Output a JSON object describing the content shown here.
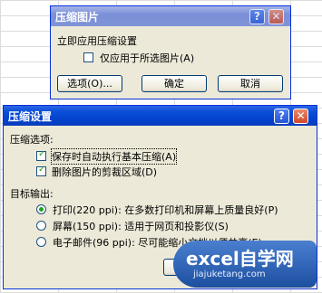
{
  "back_dialog": {
    "title": "压缩图片",
    "group_label": "立即应用压缩设置",
    "checkbox_label": "仅应用于所选图片(A)",
    "buttons": {
      "options": "选项(O)...",
      "ok": "确定",
      "cancel": "取消"
    }
  },
  "front_dialog": {
    "title": "压缩设置",
    "compress_group_label": "压缩选项:",
    "compress_options": [
      {
        "label": "保存时自动执行基本压缩(A)",
        "checked": true
      },
      {
        "label": "删除图片的剪裁区域(D)",
        "checked": true
      }
    ],
    "target_group_label": "目标输出:",
    "target_options": [
      {
        "label": "打印(220 ppi): 在多数打印机和屏幕上质量良好(P)",
        "selected": true
      },
      {
        "label": "屏幕(150 ppi): 适用于网页和投影仪(S)",
        "selected": false
      },
      {
        "label": "电子邮件(96 ppi): 尽可能缩小文档以便共享(E)",
        "selected": false
      }
    ]
  },
  "titlebar_icons": {
    "help": "?",
    "close": "✕"
  },
  "watermark": {
    "brand": "excel自学网",
    "domain": "jiajuketang.com"
  }
}
